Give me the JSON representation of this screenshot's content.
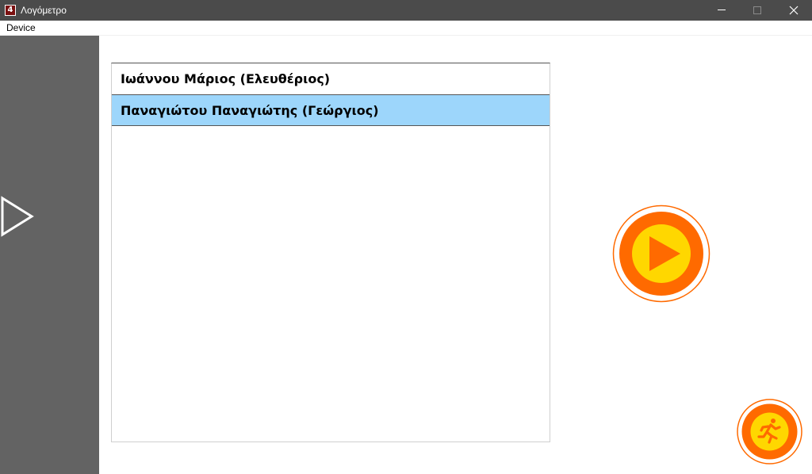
{
  "window": {
    "title": "Λογόμετρο",
    "app_icon_glyph": "4"
  },
  "menu": {
    "items": [
      "Device"
    ]
  },
  "list": {
    "items": [
      {
        "label": "Ιωάννου Μάριος (Ελευθέριος)",
        "selected": false
      },
      {
        "label": "Παναγιώτου Παναγιώτης (Γεώργιος)",
        "selected": true
      }
    ]
  },
  "colors": {
    "titlebar": "#4b4b4b",
    "left_panel": "#636363",
    "selected_row": "#9dd6fb",
    "button_orange": "#ff6a00",
    "button_yellow": "#ffd700"
  },
  "icons": {
    "left_panel": "play-outline-icon",
    "main_action": "play-icon",
    "exit_action": "running-man-icon"
  }
}
